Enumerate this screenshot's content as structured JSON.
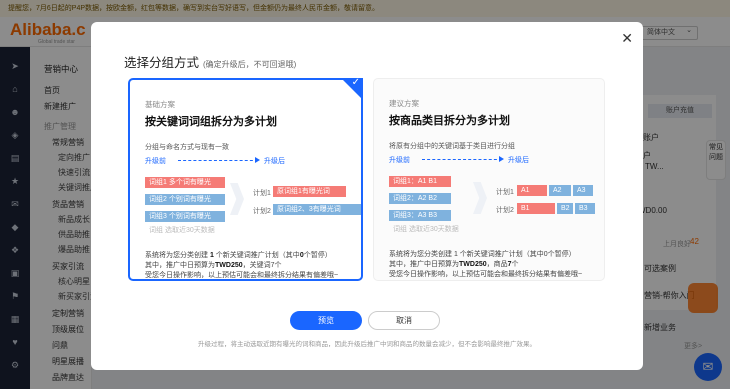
{
  "notice": "提醒您，7月6日起的P4P数据，按欧金额，红包等数据，确写到实台写好语写，但金额仍为最终人民币金额，敬请留意。",
  "brand": {
    "logo": "Alibaba.c",
    "tagline": "Global trade star"
  },
  "language": "简体中文",
  "sidebar": {
    "title": "营销中心",
    "items": [
      "首页",
      "新建推广",
      "推广管理",
      "常规营销",
      "定向推广",
      "快速引流",
      "关键词推广",
      "货品营销",
      "新品成长",
      "供品助推",
      "爆品助推",
      "买家引流",
      "核心明星",
      "新买家引流",
      "定制营销",
      "顶级展位",
      "问鼎",
      "明星展播",
      "品牌直达"
    ]
  },
  "right_panel": {
    "btn": "账户充值",
    "lbl1": "账户",
    "lbl2": "户",
    "val1": "TW...",
    "val2": "WD0.00",
    "val3": "上月良好",
    "val4": "42",
    "lbl3": "可选案例",
    "lbl4": "营销-帮你入门",
    "lbl5": "新增业务",
    "lbl6": "更多>"
  },
  "help_text": "常见问题",
  "modal": {
    "title": "选择分组方式",
    "subtitle": "(确定升级后，不可回退哦)",
    "basic": {
      "kicker": "基础方案",
      "title": "按关键词词组拆分为多计划",
      "desc": "分组与命名方式与现有一致",
      "before_label": "升级前",
      "after_label": "升级后",
      "before_groups": [
        "词组1 多个词有曝光",
        "词组2 个别词有曝光",
        "词组3 个别词有曝光",
        "词组  选取近30天数据"
      ],
      "plan_labels": [
        "计划1",
        "计划2"
      ],
      "after_groups": [
        "原词组1有曝光词",
        "原词组2、3有曝光词"
      ],
      "foot1_pre": "系统将为您分类创建 ",
      "foot1_num": "1",
      "foot1_mid": " 个新关键词推广计划（其中",
      "foot1_num2": "0",
      "foot1_post": "个暂停）",
      "foot2_pre": "其中，推广中日预算为",
      "foot2_val": "TWD250",
      "foot2_post": "，关键词7个",
      "foot3": "受您今日操作影响，以上预估可能会和最终拆分结果有偏差哦~"
    },
    "suggest": {
      "kicker": "建议方案",
      "title": "按商品类目拆分为多计划",
      "desc": "将原有分组中的关键词基于类目进行分组",
      "before_label": "升级前",
      "after_label": "升级后",
      "before_groups": [
        "词组1：A1  B1",
        "词组2：A2  B2",
        "词组3：A3  B3",
        "词组  选取近30天数据"
      ],
      "plan_labels": [
        "计划1",
        "计划2"
      ],
      "plan1_segments": [
        "A1",
        "A2",
        "A3"
      ],
      "plan2_segments": [
        "B1",
        "B2",
        "B3"
      ],
      "foot1": "系统将为您分类创建 1 个新关键词推广计划（其中0个暂停）",
      "foot2_pre": "其中，推广中日预算为",
      "foot2_val": "TWD250",
      "foot2_mid": "，商品",
      "foot2_num": "7",
      "foot2_post": "个",
      "foot3": "受您今日操作影响，以上预估可能会和最终拆分结果有偏差哦~"
    },
    "preview_btn": "预览",
    "cancel_btn": "取消",
    "hint": "升级过程，将主动选取近期有曝光的词和商品，因此升级后推广中词和商品的数量会减少，但不会影响最终推广效果。"
  }
}
